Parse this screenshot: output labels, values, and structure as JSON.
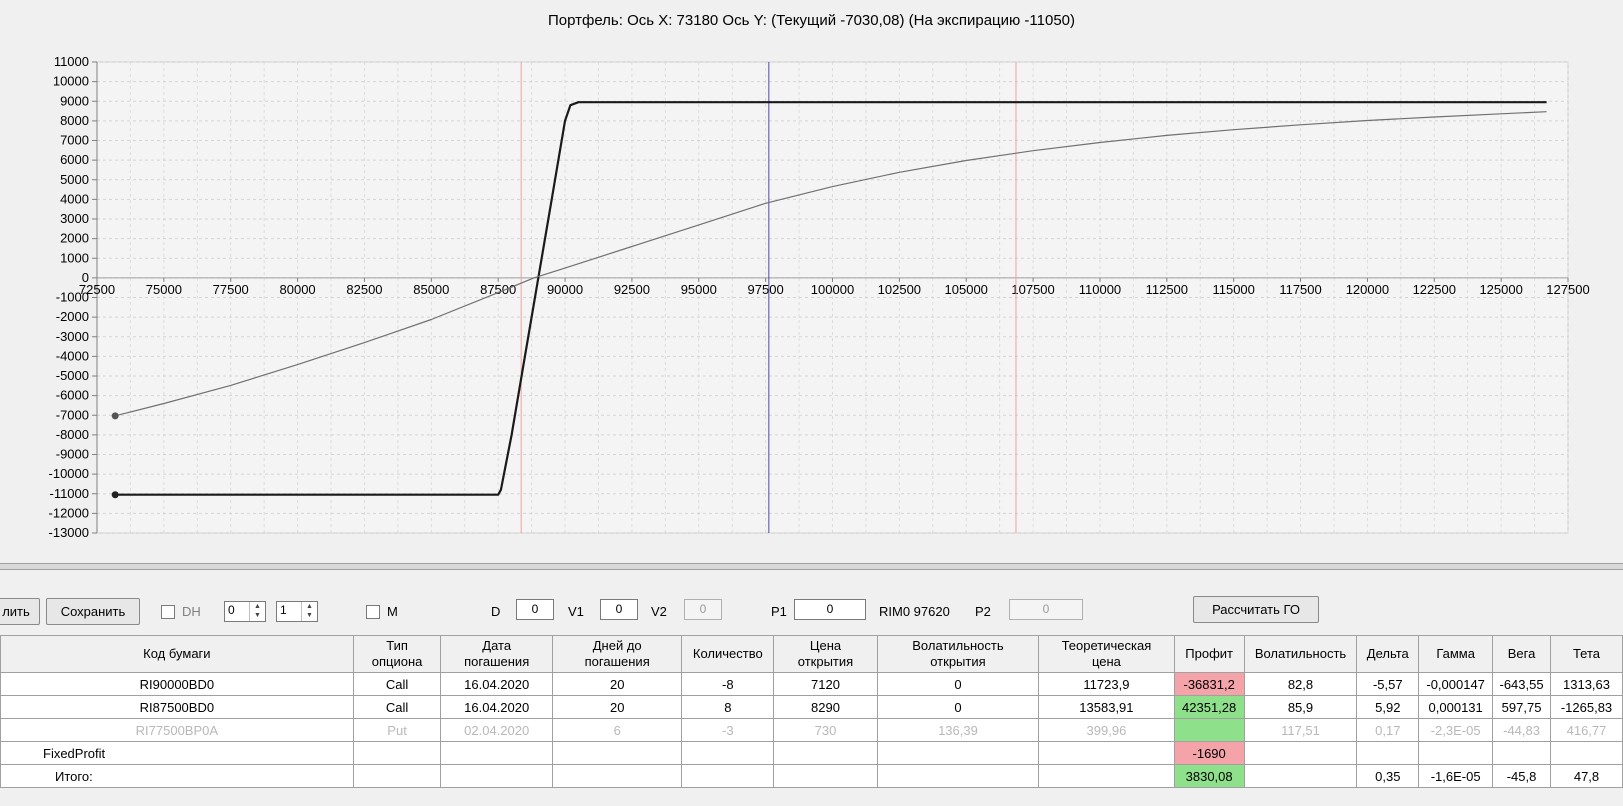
{
  "chart_data": {
    "type": "line",
    "title": "Портфель: Ось X: 73180 Ось Y:  (Текущий -7030,08)  (На экспирацию -11050)",
    "xlim": [
      72500,
      127500
    ],
    "ylim": [
      -13000,
      11000
    ],
    "x_ticks": [
      "72500",
      "75000",
      "77500",
      "80000",
      "82500",
      "85000",
      "87500",
      "90000",
      "92500",
      "95000",
      "97500",
      "100000",
      "102500",
      "105000",
      "107500",
      "110000",
      "112500",
      "115000",
      "117500",
      "120000",
      "122500",
      "125000",
      "127500"
    ],
    "y_ticks": [
      "11000",
      "10000",
      "9000",
      "8000",
      "7000",
      "6000",
      "5000",
      "4000",
      "3000",
      "2000",
      "1000",
      "0",
      "-1000",
      "-2000",
      "-3000",
      "-4000",
      "-5000",
      "-6000",
      "-7000",
      "-8000",
      "-9000",
      "-10000",
      "-11000",
      "-12000",
      "-13000"
    ],
    "grid": true,
    "series": [
      {
        "color": "#1a1a1a",
        "points": [
          [
            73180,
            -11050
          ],
          [
            76000,
            -11050
          ],
          [
            80000,
            -11050
          ],
          [
            84000,
            -11050
          ],
          [
            86000,
            -11050
          ],
          [
            87500,
            -11050
          ],
          [
            87600,
            -10800
          ],
          [
            88000,
            -8000
          ],
          [
            88500,
            -4000
          ],
          [
            89000,
            0
          ],
          [
            89500,
            4000
          ],
          [
            90000,
            8000
          ],
          [
            90200,
            8800
          ],
          [
            90500,
            8950
          ],
          [
            95000,
            8950
          ],
          [
            100000,
            8950
          ],
          [
            105000,
            8950
          ],
          [
            110000,
            8950
          ],
          [
            115000,
            8950
          ],
          [
            120000,
            8950
          ],
          [
            126700,
            8950
          ]
        ]
      },
      {
        "color": "#707070",
        "points": [
          [
            73180,
            -7030
          ],
          [
            75000,
            -6400
          ],
          [
            77500,
            -5480
          ],
          [
            80000,
            -4420
          ],
          [
            82500,
            -3300
          ],
          [
            85000,
            -2120
          ],
          [
            87500,
            -750
          ],
          [
            88830,
            0
          ],
          [
            90000,
            500
          ],
          [
            92500,
            1600
          ],
          [
            95000,
            2700
          ],
          [
            97500,
            3800
          ],
          [
            100000,
            4650
          ],
          [
            102500,
            5380
          ],
          [
            105000,
            5980
          ],
          [
            107500,
            6480
          ],
          [
            110000,
            6900
          ],
          [
            112500,
            7260
          ],
          [
            115000,
            7550
          ],
          [
            117500,
            7800
          ],
          [
            120000,
            8020
          ],
          [
            122500,
            8200
          ],
          [
            125000,
            8360
          ],
          [
            126700,
            8470
          ]
        ]
      }
    ],
    "vertical_lines": [
      {
        "x": 88360,
        "color": "#f2a0a0"
      },
      {
        "x": 97620,
        "color": "#4a4aa8"
      },
      {
        "x": 106860,
        "color": "#f2a0a0"
      }
    ],
    "markers": [
      {
        "x": 73180,
        "y": -7030,
        "color": "#555555"
      },
      {
        "x": 73180,
        "y": -11050,
        "color": "#222222"
      }
    ]
  },
  "toolbar": {
    "btn_left": "лить",
    "btn_save": "Сохранить",
    "dh_label": "DH",
    "spin1": "0",
    "spin2": "1",
    "m_label": "M",
    "d_label": "D",
    "d_val": "0",
    "v1_label": "V1",
    "v1_val": "0",
    "v2_label": "V2",
    "v2_val": "0",
    "p1_label": "P1",
    "p1_val": "0",
    "rim_label": "RIM0 97620",
    "p2_label": "P2",
    "p2_val": "0",
    "btn_go": "Рассчитать ГО"
  },
  "table": {
    "headers": {
      "h0": "Код бумаги",
      "h1a": "Тип",
      "h1b": "опциона",
      "h2a": "Дата",
      "h2b": "погашения",
      "h3a": "Дней до",
      "h3b": "погашения",
      "h4": "Количество",
      "h5a": "Цена",
      "h5b": "открытия",
      "h6a": "Волатильность",
      "h6b": "открытия",
      "h7a": "Теоретическая",
      "h7b": "цена",
      "h8": "Профит",
      "h9": "Волатильность",
      "h10": "Дельта",
      "h11": "Гамма",
      "h12": "Вега",
      "h13": "Тета"
    },
    "rows": [
      {
        "code": "RI90000BD0",
        "type": "Call",
        "date": "16.04.2020",
        "days": "20",
        "qty": "-8",
        "price": "7120",
        "vol_open": "0",
        "theo": "11723,9",
        "profit": "-36831,2",
        "vol": "82,8",
        "delta": "-5,57",
        "gamma": "-0,000147",
        "vega": "-643,55",
        "theta": "1313,63"
      },
      {
        "code": "RI87500BD0",
        "type": "Call",
        "date": "16.04.2020",
        "days": "20",
        "qty": "8",
        "price": "8290",
        "vol_open": "0",
        "theo": "13583,91",
        "profit": "42351,28",
        "vol": "85,9",
        "delta": "5,92",
        "gamma": "0,000131",
        "vega": "597,75",
        "theta": "-1265,83"
      },
      {
        "code": "RI77500BP0A",
        "type": "Put",
        "date": "02.04.2020",
        "days": "6",
        "qty": "-3",
        "price": "730",
        "vol_open": "136,39",
        "theo": "399,96",
        "profit": "",
        "vol": "117,51",
        "delta": "0,17",
        "gamma": "-2,3E-05",
        "vega": "-44,83",
        "theta": "416,77"
      }
    ],
    "fixed": {
      "label": "FixedProfit",
      "profit": "-1690"
    },
    "total": {
      "label": "Итого:",
      "profit": "3830,08",
      "delta": "0,35",
      "gamma": "-1,6E-05",
      "vega": "-45,8",
      "theta": "47,8"
    }
  }
}
